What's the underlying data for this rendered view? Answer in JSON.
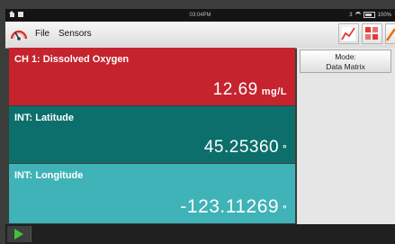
{
  "status_bar": {
    "time": "03:04PM",
    "right_text": "3",
    "battery_text": "100%"
  },
  "menu": {
    "file": "File",
    "sensors": "Sensors"
  },
  "mode": {
    "line1": "Mode:",
    "line2": "Data Matrix"
  },
  "meters": [
    {
      "label": "CH 1: Dissolved Oxygen",
      "value": "12.69",
      "unit": "mg/L",
      "color": "#c5232d"
    },
    {
      "label": "INT: Latitude",
      "value": "45.25360",
      "unit": "°",
      "color": "#0c6f6c"
    },
    {
      "label": "INT: Longitude",
      "value": "-123.11269",
      "unit": "°",
      "color": "#3fb3b7"
    }
  ],
  "icons": {
    "graph": "line-graph-icon",
    "meter": "meter-view-icon",
    "annotate": "pencil-icon",
    "logo": "gauge-logo-icon",
    "play": "play-icon"
  },
  "colors": {
    "collect_green": "#41c43b",
    "toolbar_red": "#e53935"
  }
}
